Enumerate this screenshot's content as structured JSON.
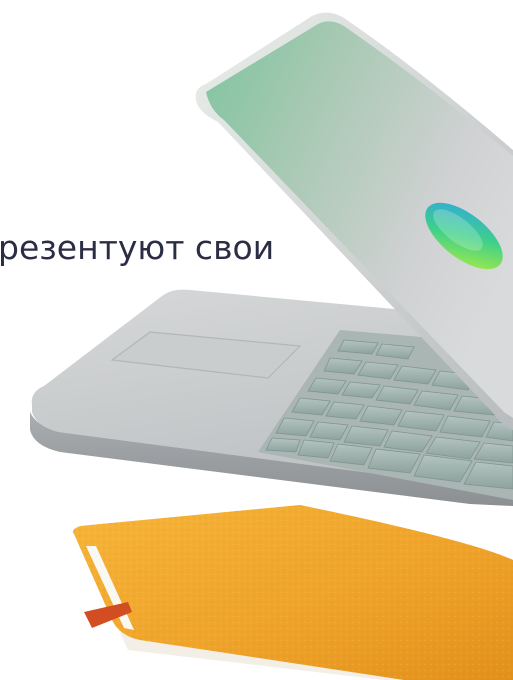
{
  "headline": {
    "text": "резентуют свои",
    "color": "#2b2d45"
  },
  "illustration": {
    "objects": [
      "laptop-lid",
      "laptop-base",
      "keyboard",
      "notebook"
    ],
    "colors": {
      "laptop_body": "#c9cbcd",
      "lid_glow": "#7fc7a2",
      "logo_gradient": [
        "#2fa3e8",
        "#3fd08a",
        "#b6ef3a"
      ],
      "notebook_cover": "#f0a52a",
      "bookmark_ribbon": "#d24e22"
    }
  }
}
